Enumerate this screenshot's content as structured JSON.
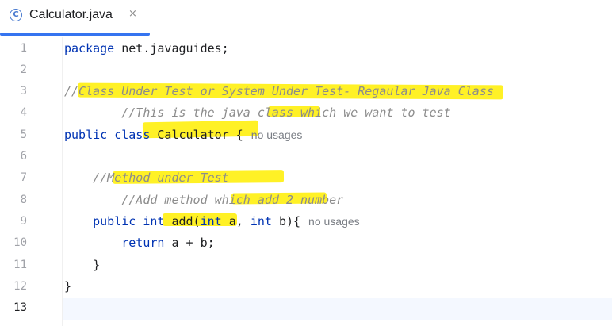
{
  "tab": {
    "icon_letter": "C",
    "label": "Calculator.java",
    "close": "×"
  },
  "editor": {
    "lines": [
      {
        "num": "1",
        "parts": [
          {
            "t": "package ",
            "c": "kw"
          },
          {
            "t": "net.javaguides;",
            "c": ""
          }
        ]
      },
      {
        "num": "2",
        "parts": []
      },
      {
        "num": "3",
        "parts": [
          {
            "t": "//Class Under Test or System Under Test- Regaular Java Class",
            "c": "cm"
          }
        ]
      },
      {
        "num": "4",
        "parts": [
          {
            "t": "        //This is the java class which we want to test",
            "c": "cm"
          }
        ]
      },
      {
        "num": "5",
        "parts": [
          {
            "t": "public class ",
            "c": "kw"
          },
          {
            "t": "Calculator {",
            "c": ""
          }
        ],
        "hint": "no usages"
      },
      {
        "num": "6",
        "parts": []
      },
      {
        "num": "7",
        "parts": [
          {
            "t": "    //Method under Test",
            "c": "cm"
          }
        ]
      },
      {
        "num": "8",
        "parts": [
          {
            "t": "        //Add method which add 2 number",
            "c": "cm"
          }
        ]
      },
      {
        "num": "9",
        "parts": [
          {
            "t": "    public int ",
            "c": "kw"
          },
          {
            "t": "add(",
            "c": ""
          },
          {
            "t": "int ",
            "c": "kw"
          },
          {
            "t": "a, ",
            "c": ""
          },
          {
            "t": "int ",
            "c": "kw"
          },
          {
            "t": "b){",
            "c": ""
          }
        ],
        "hint": "no usages"
      },
      {
        "num": "10",
        "parts": [
          {
            "t": "        return ",
            "c": "kw"
          },
          {
            "t": "a + b;",
            "c": ""
          }
        ]
      },
      {
        "num": "11",
        "parts": [
          {
            "t": "    }",
            "c": ""
          }
        ]
      },
      {
        "num": "12",
        "parts": [
          {
            "t": "}",
            "c": ""
          }
        ]
      },
      {
        "num": "13",
        "parts": [],
        "active": true
      }
    ]
  },
  "colors": {
    "keyword": "#0033b3",
    "comment": "#8c8c8c",
    "highlighter": "#ffef00",
    "tab_underline": "#3574f0"
  }
}
